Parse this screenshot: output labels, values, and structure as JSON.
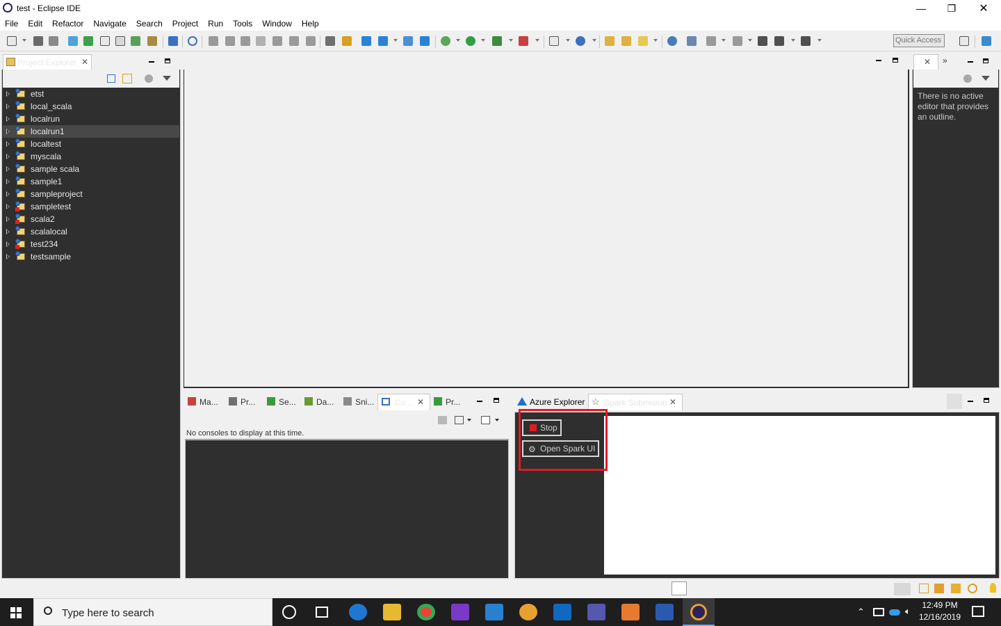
{
  "window": {
    "title": "test - Eclipse IDE"
  },
  "menu": [
    "File",
    "Edit",
    "Refactor",
    "Navigate",
    "Search",
    "Project",
    "Run",
    "Tools",
    "Window",
    "Help"
  ],
  "toolbar": {
    "quick_access_placeholder": "Quick Access"
  },
  "project_explorer": {
    "tab_label": "Project Explorer",
    "projects": [
      {
        "name": "etst",
        "error": false
      },
      {
        "name": "local_scala",
        "error": false
      },
      {
        "name": "localrun",
        "error": false
      },
      {
        "name": "localrun1",
        "error": false,
        "selected": true
      },
      {
        "name": "localtest",
        "error": false
      },
      {
        "name": "myscala",
        "error": false
      },
      {
        "name": "sample scala",
        "error": false
      },
      {
        "name": "sample1",
        "error": false
      },
      {
        "name": "sampleproject",
        "error": false
      },
      {
        "name": "sampletest",
        "error": true
      },
      {
        "name": "scala2",
        "error": true
      },
      {
        "name": "scalalocal",
        "error": false
      },
      {
        "name": "test234",
        "error": true
      },
      {
        "name": "testsample",
        "error": false
      }
    ]
  },
  "outline": {
    "message": "There is no active editor that provides an outline."
  },
  "bottom_left": {
    "tabs": [
      "Ma...",
      "Pr...",
      "Se...",
      "Da...",
      "Sni...",
      "Co...",
      "Pr..."
    ],
    "console_message": "No consoles to display at this time."
  },
  "bottom_right": {
    "azure_tab": "Azure Explorer",
    "spark_tab": "Spark Submision",
    "stop_label": "Stop",
    "open_spark_ui_label": "Open Spark UI"
  },
  "taskbar": {
    "search_placeholder": "Type here to search",
    "time": "12:49 PM",
    "date": "12/16/2019"
  },
  "colors": {
    "dark_panel": "#2f2f2f",
    "highlight": "#e11b22",
    "taskbar": "#1e1e1e"
  }
}
